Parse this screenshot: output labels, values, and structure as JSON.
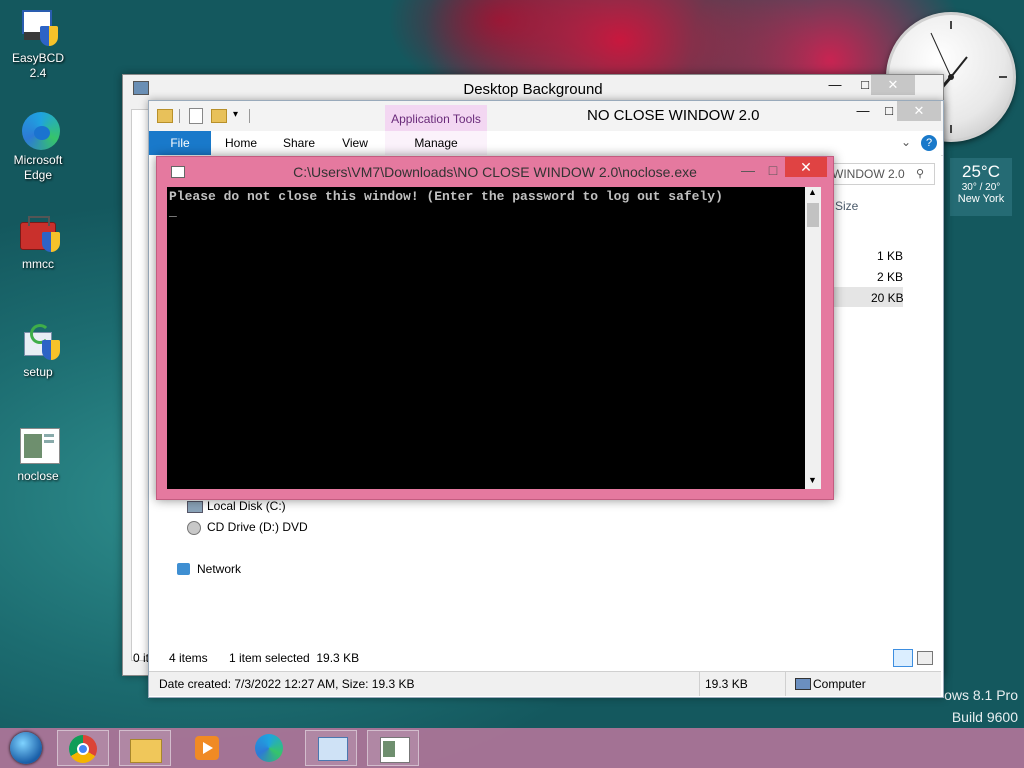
{
  "desktop": {
    "icons": [
      {
        "label": "EasyBCD 2.4"
      },
      {
        "label": "Microsoft Edge"
      },
      {
        "label": "mmcc"
      },
      {
        "label": "setup"
      },
      {
        "label": "noclose"
      }
    ],
    "weather": {
      "temp": "25°C",
      "range": "30° / 20°",
      "city": "New York"
    },
    "watermark": {
      "line1": "ows 8.1 Pro",
      "line2": "Build 9600"
    }
  },
  "back_window": {
    "title": "Desktop Background",
    "left_status": "0 it"
  },
  "explorer": {
    "title": "NO CLOSE WINDOW 2.0",
    "context_tab": "Application Tools",
    "tabs": {
      "file": "File",
      "home": "Home",
      "share": "Share",
      "view": "View",
      "manage": "Manage"
    },
    "search_text": "WINDOW 2.0",
    "size_header": "Size",
    "sizes": [
      "1 KB",
      "2 KB",
      "20 KB"
    ],
    "nav": {
      "local_disk": "Local Disk (C:)",
      "cd_drive": "CD Drive (D:) DVD",
      "network": "Network"
    },
    "status": {
      "items": "4 items",
      "selected": "1 item selected  19.3 KB"
    },
    "details_bar": {
      "created": "Date created: 7/3/2022 12:27 AM, Size: 19.3 KB",
      "size": "19.3 KB",
      "location": "Computer"
    }
  },
  "console": {
    "title": "C:\\Users\\VM7\\Downloads\\NO CLOSE WINDOW 2.0\\noclose.exe",
    "line1": "Please do not close this window! (Enter the password to log out safely)",
    "cursor": "_"
  },
  "colors": {
    "console_frame": "#e5799f",
    "close_button": "#e04343",
    "taskbar": "#b2769a"
  }
}
